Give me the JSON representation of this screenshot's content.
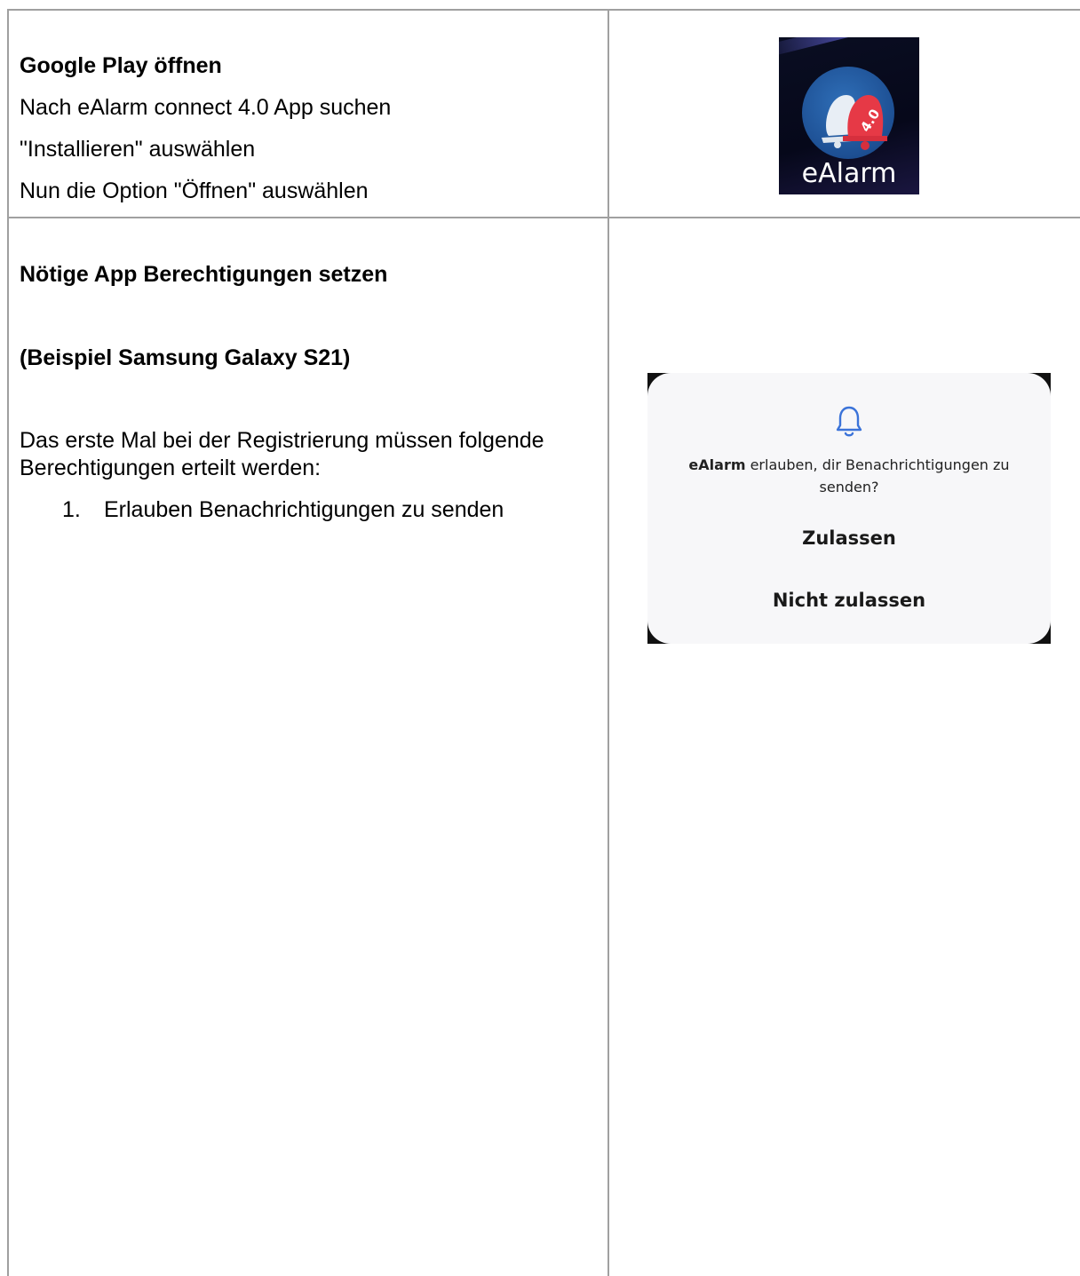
{
  "row1": {
    "title": "Google Play öffnen",
    "lines": [
      "Nach eAlarm connect 4.0 App suchen",
      "\"Installieren\" auswählen",
      "Nun die Option \"Öffnen\" auswählen"
    ],
    "app_icon": {
      "label": "eAlarm",
      "badge": "4.0",
      "icon_names": [
        "bell-icon-white",
        "bell-icon-red"
      ],
      "colors": {
        "background": "#080b1e",
        "circle": "#1d4f93",
        "bell_white": "#e8eef5",
        "bell_red": "#e63946"
      }
    }
  },
  "row2": {
    "title": "Nötige App Berechtigungen setzen",
    "subtitle": "(Beispiel Samsung Galaxy S21)",
    "paragraph": "Das erste Mal bei der Registrierung müssen folgende Berechtigungen erteilt werden:",
    "list": [
      {
        "number": "1.",
        "text": "Erlauben Benachrichtigungen zu senden"
      }
    ],
    "dialog": {
      "icon": "bell-icon",
      "app_name": "eAlarm",
      "prompt_rest": " erlauben, dir Benachrichtigungen zu senden?",
      "allow_label": "Zulassen",
      "deny_label": "Nicht zulassen",
      "colors": {
        "accent": "#3b73d9",
        "background": "#f7f7f9"
      }
    }
  }
}
